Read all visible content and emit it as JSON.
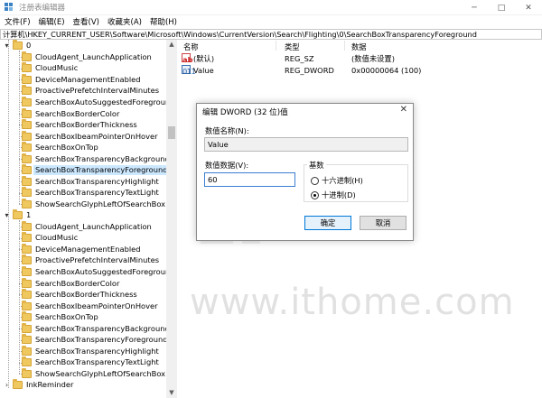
{
  "window": {
    "title": "注册表编辑器",
    "controls": {
      "minimize": "─",
      "maximize": "□",
      "close": "✕"
    }
  },
  "menu": [
    "文件(F)",
    "编辑(E)",
    "查看(V)",
    "收藏夹(A)",
    "帮助(H)"
  ],
  "address": "计算机\\HKEY_CURRENT_USER\\Software\\Microsoft\\Windows\\CurrentVersion\\Search\\Flighting\\0\\SearchBoxTransparencyForeground",
  "tree": {
    "group0": {
      "label": "0",
      "expander": "▾",
      "children": [
        "CloudAgent_LaunchApplication",
        "CloudMusic",
        "DeviceManagementEnabled",
        "ProactivePrefetchIntervalMinutes",
        "SearchBoxAutoSuggestedForegroundCo",
        "SearchBoxBorderColor",
        "SearchBoxBorderThickness",
        "SearchBoxIbeamPointerOnHover",
        "SearchBoxOnTop",
        "SearchBoxTransparencyBackground",
        "SearchBoxTransparencyForeground",
        "SearchBoxTransparencyHighlight",
        "SearchBoxTransparencyTextLight",
        "ShowSearchGlyphLeftOfSearchBox"
      ]
    },
    "group1": {
      "label": "1",
      "expander": "▾",
      "children": [
        "CloudAgent_LaunchApplication",
        "CloudMusic",
        "DeviceManagementEnabled",
        "ProactivePrefetchIntervalMinutes",
        "SearchBoxAutoSuggestedForegroundCo",
        "SearchBoxBorderColor",
        "SearchBoxBorderThickness",
        "SearchBoxIbeamPointerOnHover",
        "SearchBoxOnTop",
        "SearchBoxTransparencyBackground",
        "SearchBoxTransparencyForeground",
        "SearchBoxTransparencyHighlight",
        "SearchBoxTransparencyTextLight",
        "ShowSearchGlyphLeftOfSearchBox"
      ]
    },
    "last": {
      "label": "InkReminder",
      "expander": "›"
    },
    "selected_label": "SearchBoxTransparencyForeground"
  },
  "scroll": {
    "up": "▲",
    "down": "▼"
  },
  "values": {
    "headers": {
      "name": "名称",
      "type": "类型",
      "data": "数据"
    },
    "rows": [
      {
        "icon": "ab",
        "name": "(默认)",
        "type": "REG_SZ",
        "data": "(数值未设置)"
      },
      {
        "icon": "011",
        "name": "Value",
        "type": "REG_DWORD",
        "data": "0x00000064 (100)"
      }
    ]
  },
  "dialog": {
    "title": "编辑 DWORD (32 位)值",
    "close": "✕",
    "name_label": "数值名称(N):",
    "name_value": "Value",
    "data_label": "数值数据(V):",
    "data_value": "60",
    "base_label": "基数",
    "base_hex": "十六进制(H)",
    "base_dec": "十进制(D)",
    "ok": "确定",
    "cancel": "取消"
  },
  "watermark": "www.ithome.com",
  "colors": {
    "selection": "#cce8ff",
    "accent": "#0078d7",
    "folder": "#f0c860"
  }
}
